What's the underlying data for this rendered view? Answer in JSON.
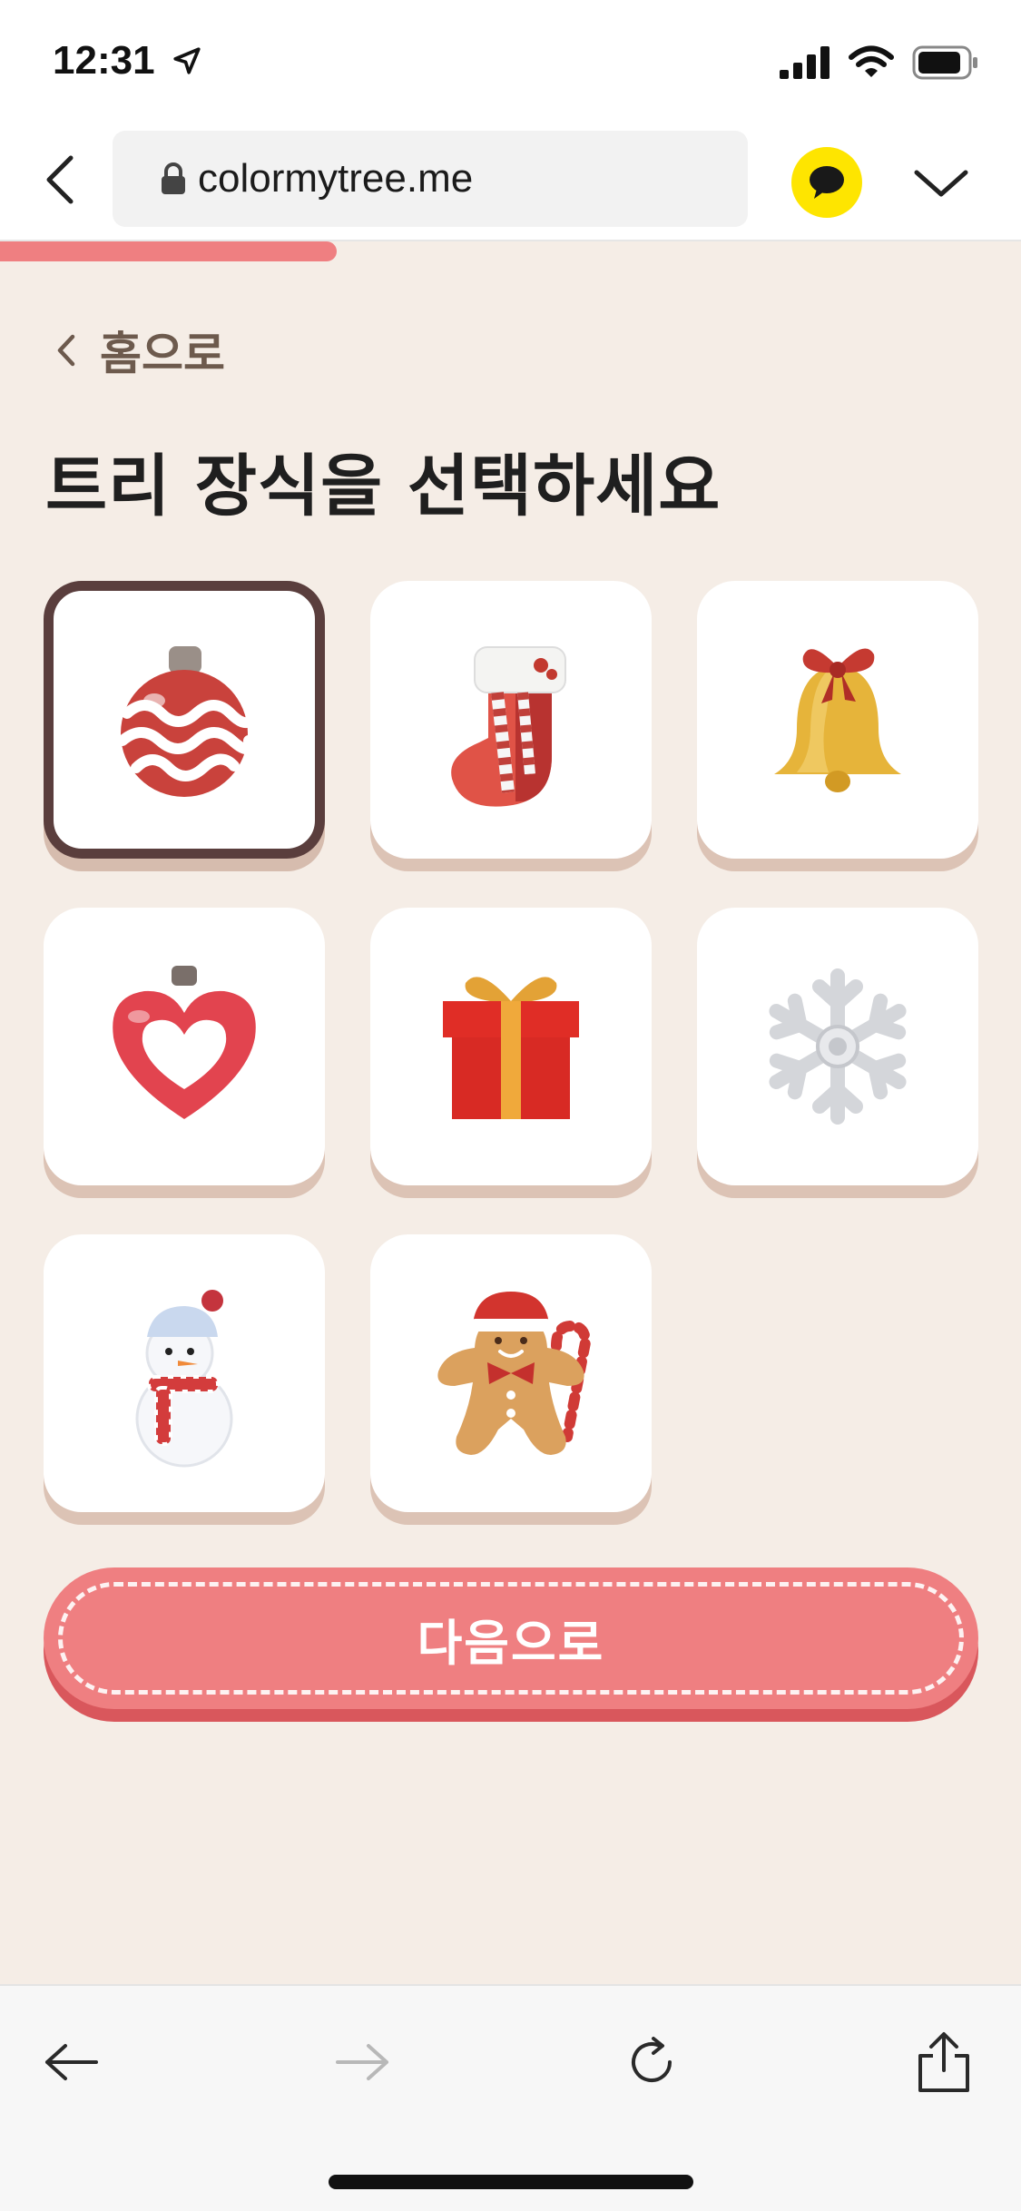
{
  "status_bar": {
    "time": "12:31"
  },
  "browser": {
    "url": "colormytree.me"
  },
  "progress": {
    "fraction": 0.33,
    "color": "#ef7f81"
  },
  "page": {
    "back_label": "홈으로",
    "title": "트리 장식을 선택하세요"
  },
  "decorations": [
    {
      "name": "ornament-ball",
      "selected": true
    },
    {
      "name": "stocking",
      "selected": false
    },
    {
      "name": "bell",
      "selected": false
    },
    {
      "name": "heart-ornament",
      "selected": false
    },
    {
      "name": "gift-box",
      "selected": false
    },
    {
      "name": "snowflake",
      "selected": false
    },
    {
      "name": "snowman",
      "selected": false
    },
    {
      "name": "gingerbread-man",
      "selected": false
    }
  ],
  "next_button": {
    "label": "다음으로"
  },
  "colors": {
    "background": "#f5ede6",
    "accent": "#ef7f81",
    "selected_border": "#5a3e3d",
    "kakao": "#fee500"
  },
  "icons": {
    "status": [
      "location-arrow-icon",
      "signal-icon",
      "wifi-icon",
      "battery-icon"
    ],
    "browser": [
      "back-chevron-icon",
      "lock-icon",
      "kakao-chat-icon",
      "chevron-down-icon"
    ],
    "toolbar": [
      "back-arrow-icon",
      "forward-arrow-icon",
      "reload-icon",
      "share-icon"
    ]
  }
}
